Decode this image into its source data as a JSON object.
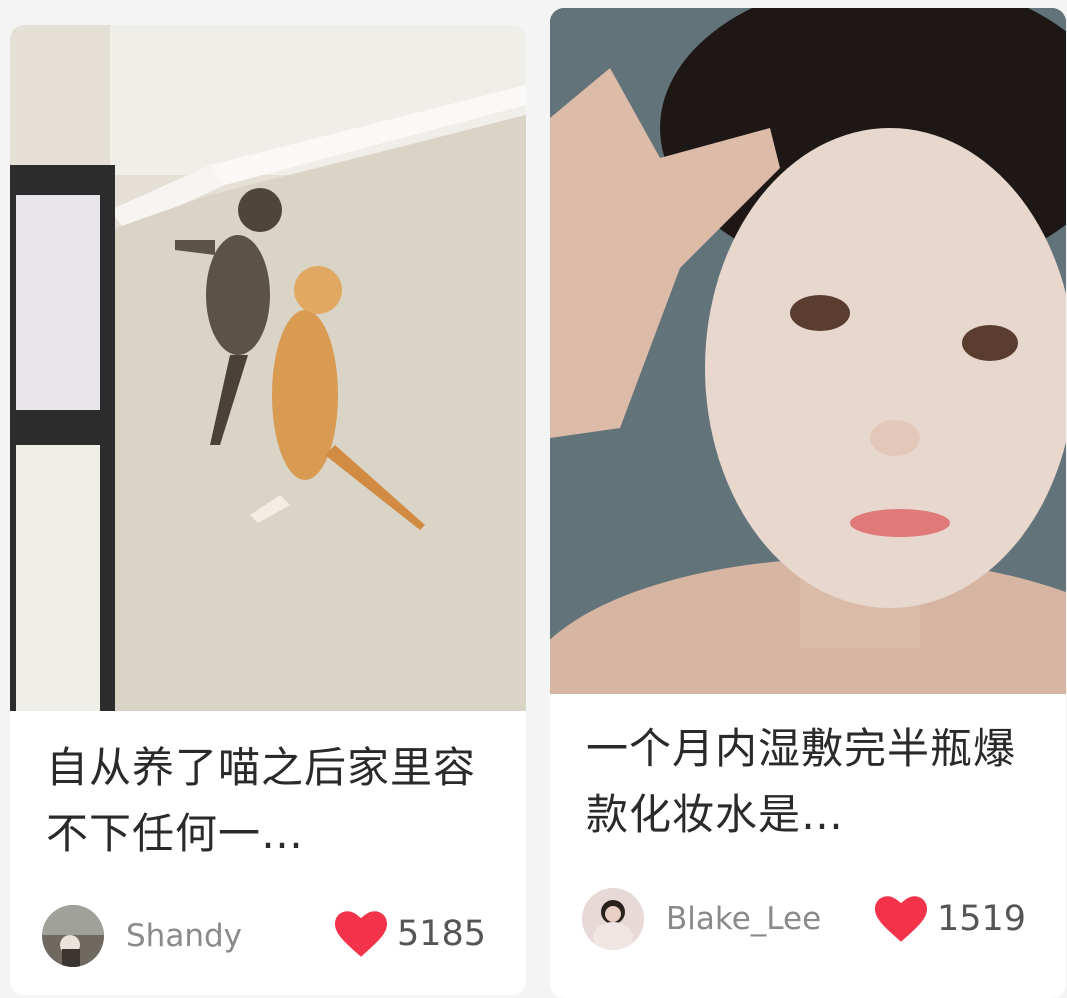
{
  "feed": {
    "cards": [
      {
        "title": "自从养了喵之后家里容不下任何一…",
        "author": "Shandy",
        "likes": "5185",
        "image_icon": "cats-climbing-wall-photo",
        "avatar_icon": "user-avatar",
        "like_icon": "heart-icon",
        "like_color": "#f2334a"
      },
      {
        "title": "一个月内湿敷完半瓶爆款化妆水是…",
        "author": "Blake_Lee",
        "likes": "1519",
        "image_icon": "face-mask-selfie-photo",
        "avatar_icon": "user-avatar",
        "like_icon": "heart-icon",
        "like_color": "#f2334a"
      }
    ]
  }
}
